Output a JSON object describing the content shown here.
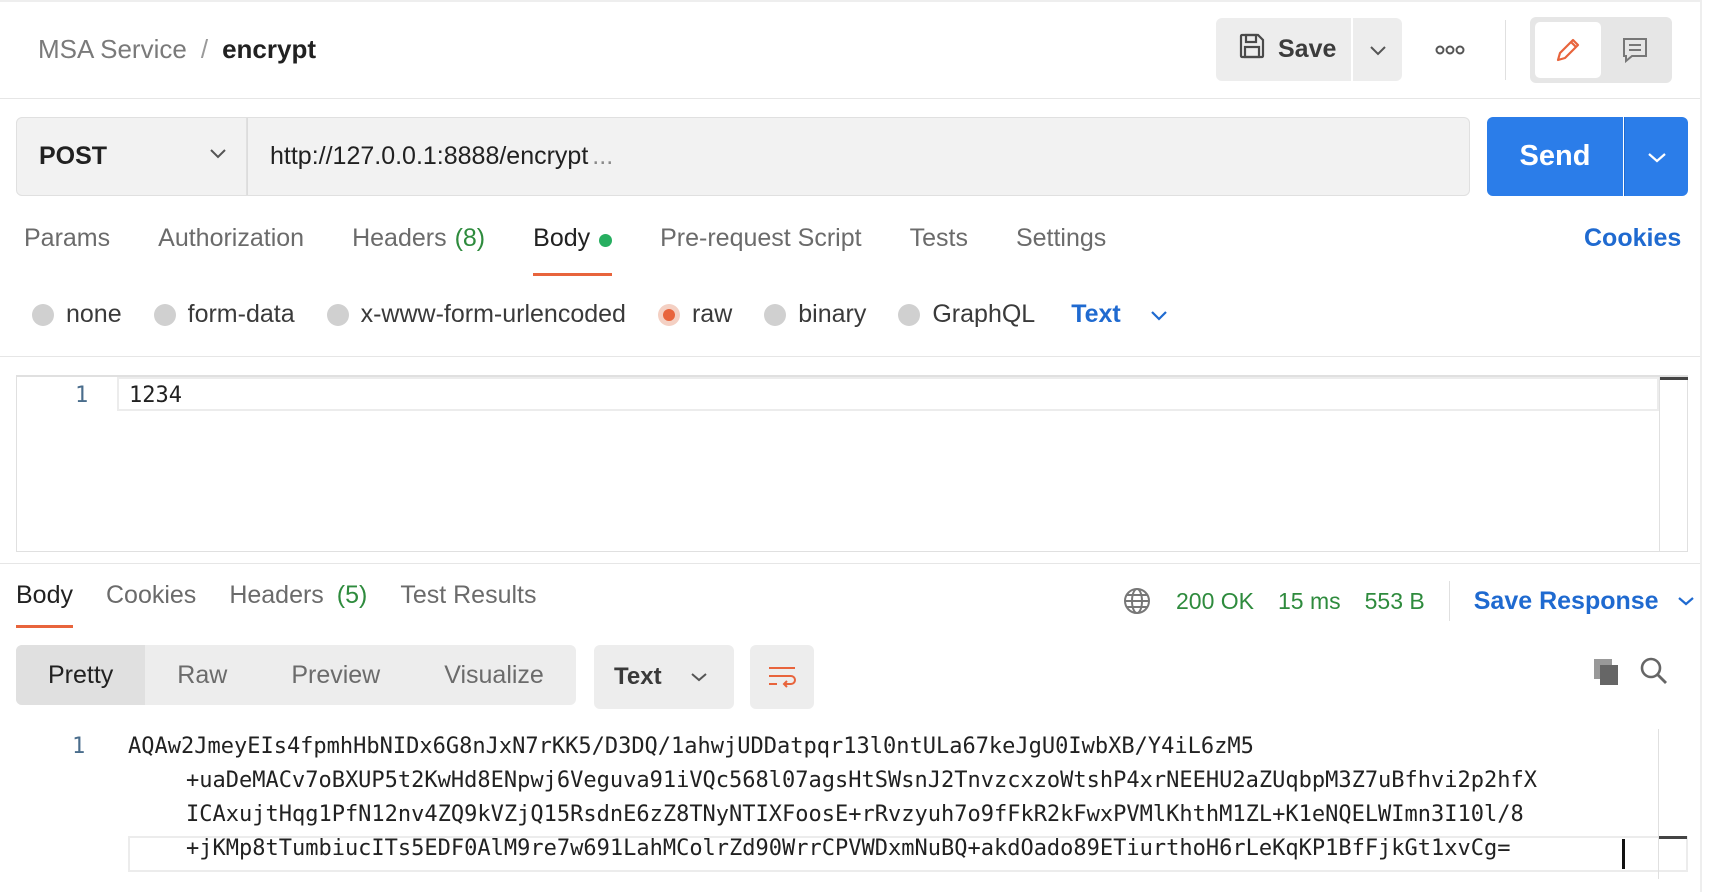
{
  "breadcrumb": {
    "parent": "MSA Service",
    "separator": "/",
    "current": "encrypt"
  },
  "toolbar": {
    "save_label": "Save",
    "more_icon": "ooo"
  },
  "request": {
    "method": "POST",
    "url": "http://127.0.0.1:8888/encrypt",
    "url_ellipsis": "...",
    "send_label": "Send"
  },
  "request_tabs": {
    "params": "Params",
    "authorization": "Authorization",
    "headers": "Headers",
    "headers_count": "(8)",
    "body": "Body",
    "pre_request": "Pre-request Script",
    "tests": "Tests",
    "settings": "Settings",
    "cookies": "Cookies"
  },
  "body_types": {
    "none": "none",
    "form_data": "form-data",
    "urlencoded": "x-www-form-urlencoded",
    "raw": "raw",
    "binary": "binary",
    "graphql": "GraphQL",
    "format": "Text"
  },
  "request_body": {
    "line_number": "1",
    "content": "1234"
  },
  "response_tabs": {
    "body": "Body",
    "cookies": "Cookies",
    "headers": "Headers",
    "headers_count": "(5)",
    "test_results": "Test Results"
  },
  "response_meta": {
    "status": "200 OK",
    "time": "15 ms",
    "size": "553 B",
    "save_response": "Save Response"
  },
  "view_tabs": {
    "pretty": "Pretty",
    "raw": "Raw",
    "preview": "Preview",
    "visualize": "Visualize",
    "format": "Text"
  },
  "response_body": {
    "line_number": "1",
    "lines": [
      "AQAw2JmeyEIs4fpmhHbNIDx6G8nJxN7rKK5/D3DQ/1ahwjUDDatpqr13l0ntULa67keJgU0IwbXB/Y4iL6zM5",
      "+uaDeMACv7oBXUP5t2KwHd8ENpwj6Veguva91iVQc568l07agsHtSWsnJ2TnvzcxzoWtshP4xrNEEHU2aZUqbpM3Z7uBfhvi2p2hfX",
      "ICAxujtHqg1PfN12nv4ZQ9kVZjQ15RsdnE6zZ8TNyNTIXFoosE+rRvzyuh7o9fFkR2kFwxPVMlKhthM1ZL+K1eNQELWImn3I10l/8",
      "+jKMp8tTumbiucITs5EDF0AlM9re7w691LahMColrZd90WrrCPVWDxmNuBQ+akdOado89ETiurthoH6rLeKqKP1BfFjkGt1xvCg="
    ]
  },
  "colors": {
    "accent": "#e8643c",
    "primary": "#2b7de9",
    "success": "#2e8b3d"
  }
}
